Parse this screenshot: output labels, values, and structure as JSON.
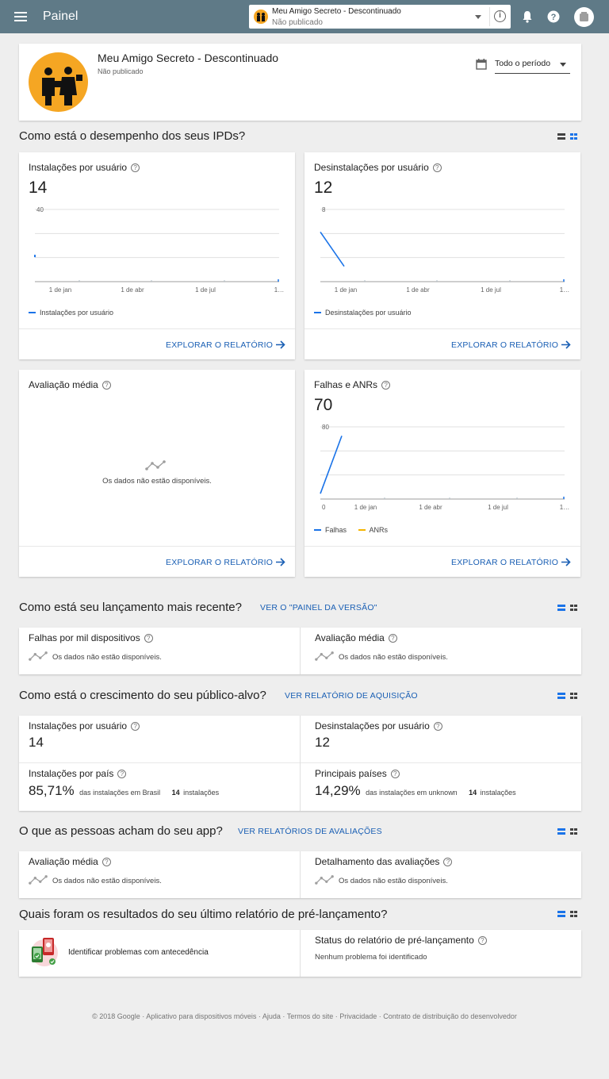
{
  "topbar": {
    "title": "Painel",
    "app_name": "Meu Amigo Secreto - Descontinuado",
    "app_status": "Não publicado"
  },
  "header": {
    "app_name": "Meu Amigo Secreto - Descontinuado",
    "app_status": "Não publicado",
    "period": "Todo o período"
  },
  "sections": {
    "performance": "Como está o desempenho dos seus IPDs?",
    "release": "Como está seu lançamento mais recente?",
    "release_link": "VER O \"PAINEL DA VERSÃO\"",
    "growth": "Como está o crescimento do seu público-alvo?",
    "growth_link": "VER RELATÓRIO DE AQUISIÇÃO",
    "reviews": "O que as pessoas acham do seu app?",
    "reviews_link": "VER RELATÓRIOS DE AVALIAÇÕES",
    "prelaunch": "Quais foram os resultados do seu último relatório de pré-lançamento?"
  },
  "explore_label": "EXPLORAR O RELATÓRIO",
  "na_text": "Os dados não estão disponíveis.",
  "colors": {
    "accent": "#1a73e8",
    "anr": "#f4b400",
    "topbar": "#5f7a87"
  },
  "cards": {
    "installs": {
      "title": "Instalações por usuário",
      "value": "14",
      "legend": "Instalações por usuário",
      "chart_data": {
        "type": "line",
        "ymax_label": "40",
        "ylim": [
          0,
          40
        ],
        "x_ticks": [
          "1 de jan",
          "1 de abr",
          "1 de jul",
          "1…"
        ],
        "series": [
          {
            "name": "Instalações por usuário",
            "points": [
              [
                0,
                14
              ]
            ]
          }
        ]
      }
    },
    "uninstalls": {
      "title": "Desinstalações por usuário",
      "value": "12",
      "legend": "Desinstalações por usuário",
      "chart_data": {
        "type": "line",
        "ymax_label": "8",
        "ylim": [
          0,
          8
        ],
        "x_ticks": [
          "1 de jan",
          "1 de abr",
          "1 de jul",
          "1…"
        ],
        "series": [
          {
            "name": "Desinstalações por usuário",
            "points": [
              [
                0,
                5.5
              ],
              [
                1,
                1.7
              ]
            ]
          }
        ]
      }
    },
    "rating": {
      "title": "Avaliação média"
    },
    "crashes": {
      "title": "Falhas e ANRs",
      "value": "70",
      "chart_data": {
        "type": "line",
        "ymax_label": "80",
        "ymin_label": "0",
        "ylim": [
          0,
          80
        ],
        "x_ticks": [
          "1 de jan",
          "1 de abr",
          "1 de jul",
          "1…"
        ],
        "series": [
          {
            "name": "Falhas",
            "points": [
              [
                0,
                6
              ],
              [
                1,
                70
              ]
            ]
          },
          {
            "name": "ANRs",
            "points": []
          }
        ]
      }
    }
  },
  "release": {
    "crashes_title": "Falhas por mil dispositivos",
    "rating_title": "Avaliação média"
  },
  "growth": {
    "installs_title": "Instalações por usuário",
    "installs_value": "14",
    "uninstalls_title": "Desinstalações por usuário",
    "uninstalls_value": "12",
    "country_title": "Instalações por país",
    "country_pct": "85,71%",
    "country_desc": "das instalações em Brasil",
    "country_count": "14",
    "country_count_label": "instalações",
    "top_title": "Principais países",
    "top_pct": "14,29%",
    "top_desc": "das instalações em unknown",
    "top_count": "14",
    "top_count_label": "instalações"
  },
  "reviews": {
    "rating_title": "Avaliação média",
    "breakdown_title": "Detalhamento das avaliações"
  },
  "prelaunch": {
    "identify": "Identificar problemas com antecedência",
    "status_title": "Status do relatório de pré-lançamento",
    "status_text": "Nenhum problema foi identificado"
  },
  "footer": "© 2018 Google · Aplicativo para dispositivos móveis · Ajuda · Termos do site · Privacidade · Contrato de distribuição do desenvolvedor"
}
